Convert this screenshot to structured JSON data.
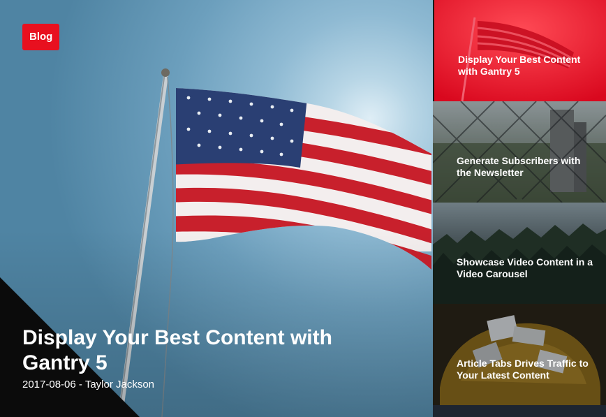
{
  "hero": {
    "badge": "Blog",
    "title": "Display Your Best Content with Gantry 5",
    "date": "2017-08-06",
    "separator": "-",
    "author": "Taylor Jackson"
  },
  "sidebar": {
    "items": [
      {
        "title": "Display Your Best Content with Gantry 5"
      },
      {
        "title": "Generate Subscribers with the Newsletter"
      },
      {
        "title": "Showcase Video Content in a Video Carousel"
      },
      {
        "title": "Article Tabs Drives Traffic to Your Latest Content"
      }
    ]
  },
  "colors": {
    "accent": "#e8101f",
    "corner": "#0b0b0b"
  }
}
